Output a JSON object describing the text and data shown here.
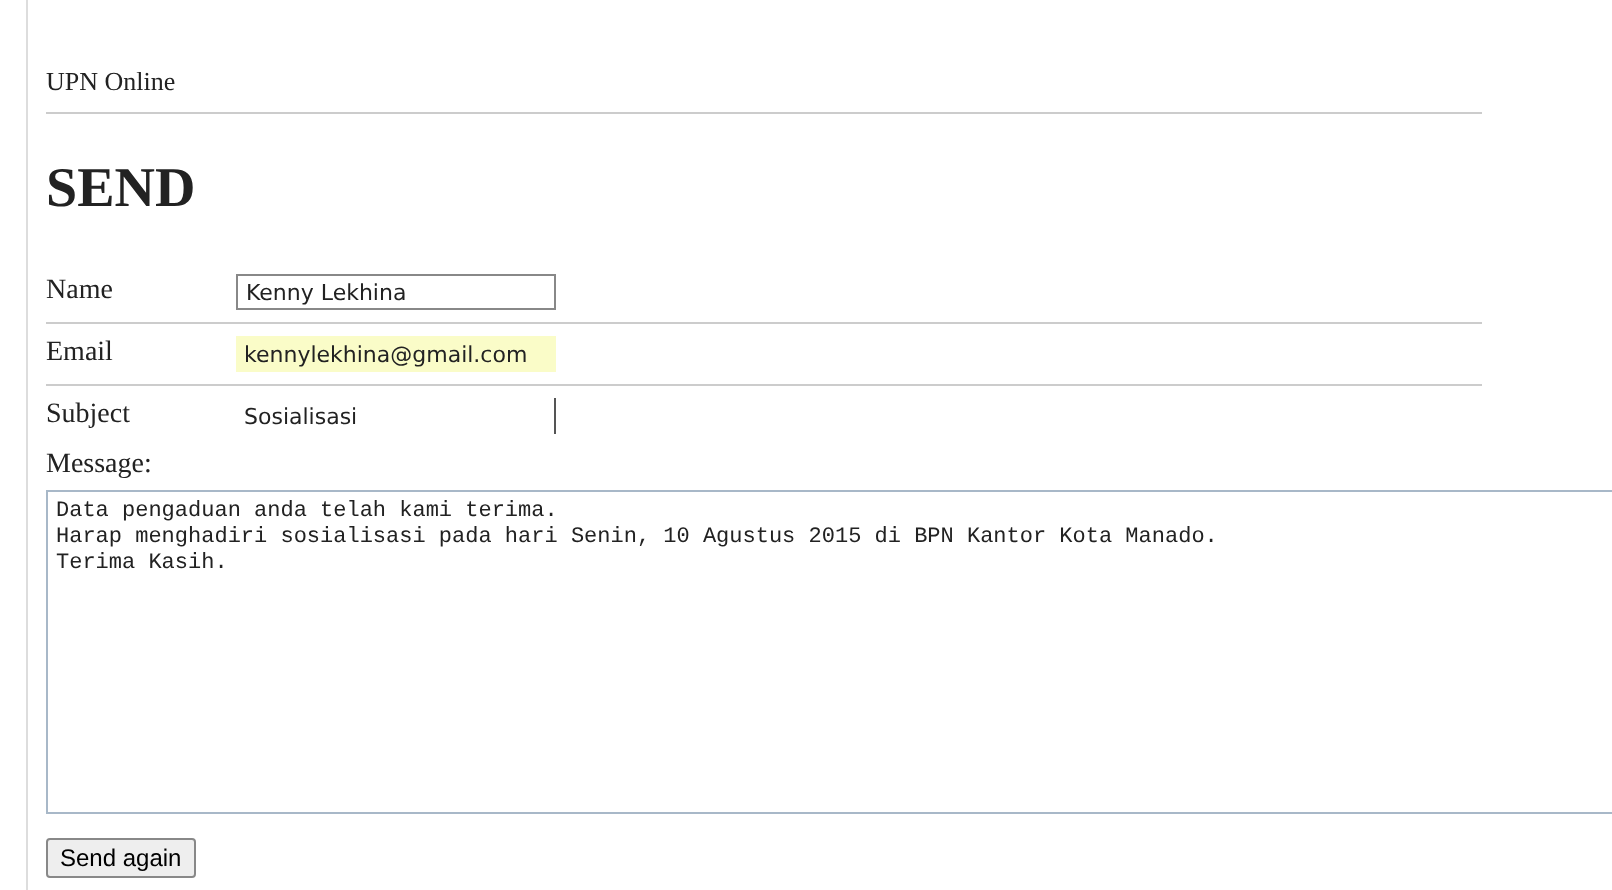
{
  "site": {
    "title": "UPN Online"
  },
  "heading": "SEND",
  "fields": [
    {
      "label": "Name",
      "value": "Kenny Lekhina",
      "kind": "boxed"
    },
    {
      "label": "Email",
      "value": "kennylekhina@gmail.com",
      "kind": "autofill"
    },
    {
      "label": "Subject",
      "value": "Sosialisasi",
      "kind": "plain"
    }
  ],
  "message": {
    "label": "Message:",
    "value": "Data pengaduan anda telah kami terima.\nHarap menghadiri sosialisasi pada hari Senin, 10 Agustus 2015 di BPN Kantor Kota Manado.\nTerima Kasih."
  },
  "button": "Send again"
}
